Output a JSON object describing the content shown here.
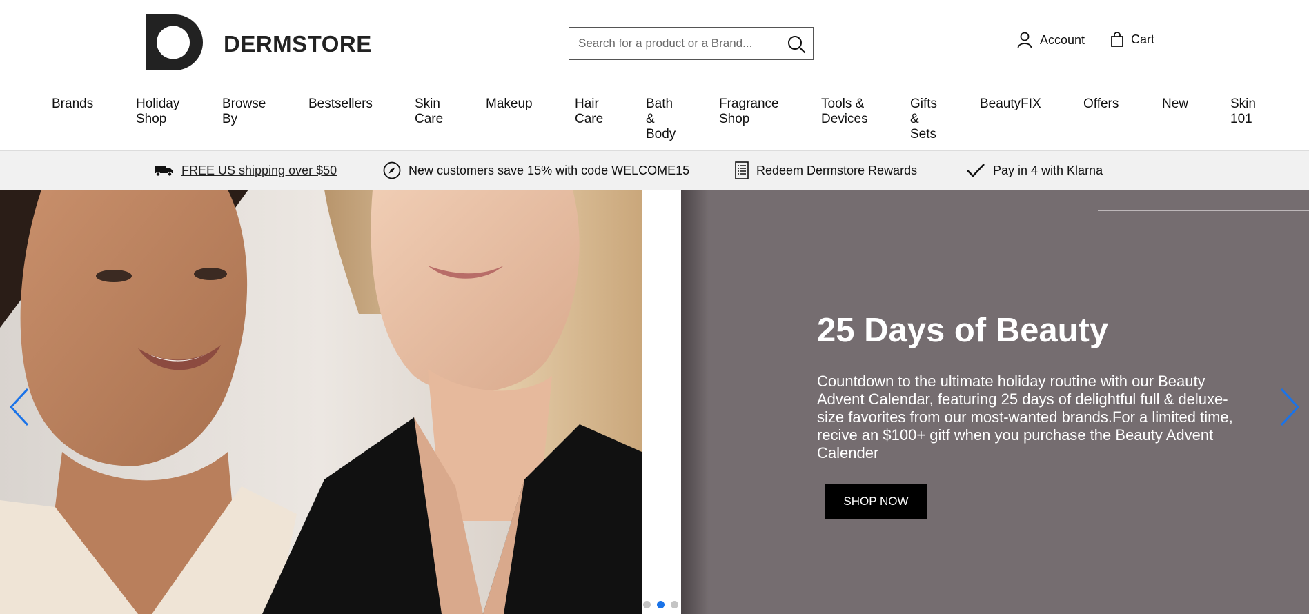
{
  "brand": {
    "name": "DERMSTORE"
  },
  "search": {
    "placeholder": "Search for a product or a Brand..."
  },
  "account": {
    "label": "Account"
  },
  "cart": {
    "label": "Cart"
  },
  "nav": {
    "items": [
      {
        "label": "Brands"
      },
      {
        "label": "Holiday Shop"
      },
      {
        "label": "Browse By"
      },
      {
        "label": "Bestsellers"
      },
      {
        "label": "Skin Care"
      },
      {
        "label": "Makeup"
      },
      {
        "label": "Hair Care"
      },
      {
        "label": "Bath & Body"
      },
      {
        "label": "Fragrance Shop"
      },
      {
        "label": "Tools & Devices"
      },
      {
        "label": "Gifts & Sets"
      },
      {
        "label": "BeautyFIX"
      },
      {
        "label": "Offers"
      },
      {
        "label": "New"
      },
      {
        "label": "Skin 101"
      }
    ]
  },
  "promo": {
    "shipping": "FREE US shipping over $50",
    "new_customers": "New customers save 15% with code WELCOME15",
    "rewards": "Redeem Dermstore Rewards",
    "klarna": "Pay in 4 with Klarna"
  },
  "hero": {
    "title": "25 Days of Beauty",
    "body": "Countdown to the ultimate holiday routine with our Beauty Advent Calendar, featuring 25 days of delightful full & deluxe-size favorites from our most-wanted brands.For a limited time, recive an $100+ gitf when you purchase the Beauty Advent Calender",
    "cta": "SHOP NOW",
    "slide_count": 3,
    "active_slide": 2
  },
  "colors": {
    "hero_panel": "#756d70",
    "promo_bg": "#f1f1f1",
    "carousel_arrow": "#1a73e8",
    "cta_bg": "#000000"
  },
  "icons": [
    "dermstore-logo",
    "search-icon",
    "user-icon",
    "bag-icon",
    "truck-icon",
    "compass-icon",
    "receipt-icon",
    "checkmark-icon",
    "chevron-left-icon",
    "chevron-right-icon"
  ]
}
